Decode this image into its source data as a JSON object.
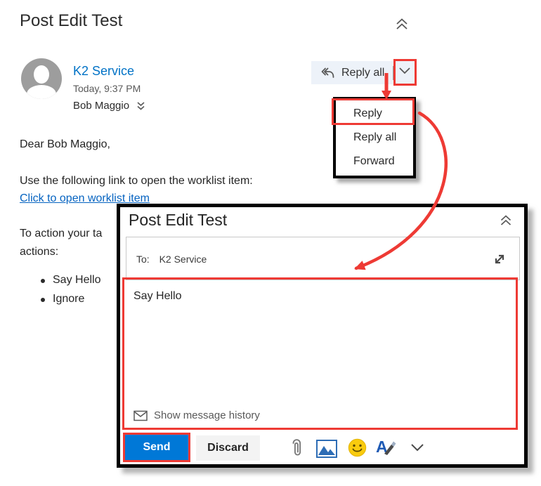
{
  "main_email": {
    "subject": "Post Edit Test",
    "sender": "K2 Service",
    "timestamp": "Today, 9:37 PM",
    "recipient": "Bob Maggio",
    "greeting": "Dear Bob Maggio,",
    "instruction_line": "Use the following link to open the worklist item:",
    "worklist_link": "Click to open worklist item",
    "action_line_visible_1": "To action your ta",
    "action_line_visible_2": "actions:",
    "bullets": [
      "Say Hello",
      "Ignore"
    ],
    "reply_all_label": "Reply all"
  },
  "dropdown_menu": {
    "items": [
      "Reply",
      "Reply all",
      "Forward"
    ]
  },
  "compose": {
    "subject": "Post Edit Test",
    "to_label": "To:",
    "to_value": "K2 Service",
    "body_text": "Say Hello",
    "show_history_label": "Show message history",
    "send_label": "Send",
    "discard_label": "Discard",
    "format_icon_letter": "A"
  },
  "colors": {
    "annotation_red": "#ee3a34",
    "send_button_blue": "#0078d7",
    "sender_link_blue": "#0072c6",
    "hyperlink_blue": "#0563c1"
  }
}
